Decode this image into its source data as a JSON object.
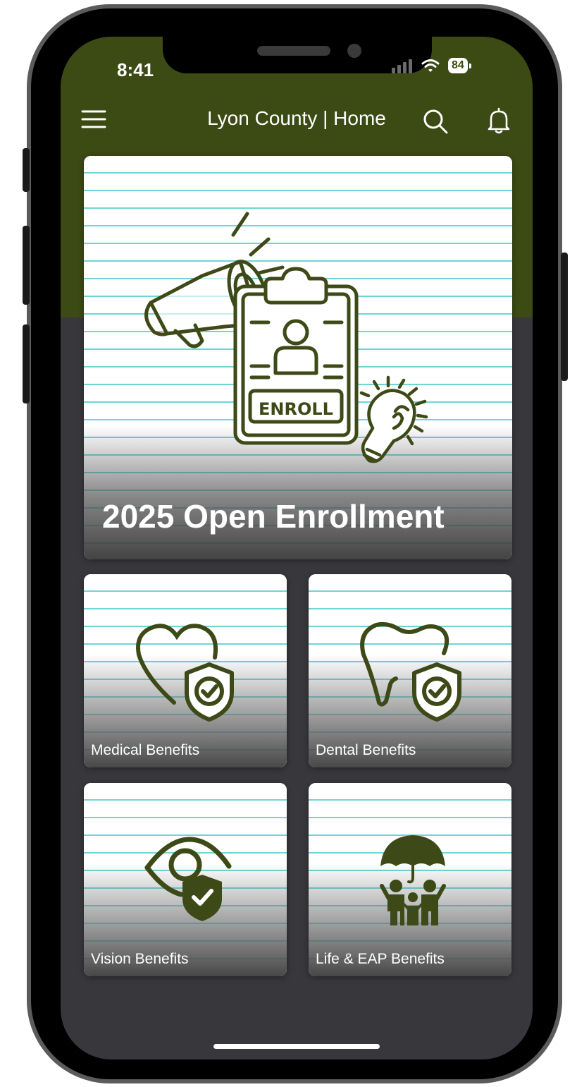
{
  "status_bar": {
    "time": "8:41",
    "battery": "84"
  },
  "header": {
    "title": "Lyon County | Home",
    "menu_icon": "hamburger-icon",
    "search_icon": "search-icon",
    "notifications_icon": "bell-icon"
  },
  "hero": {
    "title": "2025 Open Enrollment",
    "badge_text": "ENROLL",
    "icons": [
      "megaphone-icon",
      "clipboard-icon",
      "lightbulb-icon"
    ]
  },
  "tiles": [
    {
      "label": "Medical Benefits",
      "icon": "heart-shield-icon"
    },
    {
      "label": "Dental Benefits",
      "icon": "tooth-shield-icon"
    },
    {
      "label": "Vision Benefits",
      "icon": "eye-shield-icon"
    },
    {
      "label": "Life & EAP Benefits",
      "icon": "family-umbrella-icon"
    }
  ],
  "colors": {
    "brand_green": "#3c4a14",
    "icon_green": "#3d4a17",
    "screen_bg": "#38373c",
    "stripe": "#6fd5d8"
  }
}
